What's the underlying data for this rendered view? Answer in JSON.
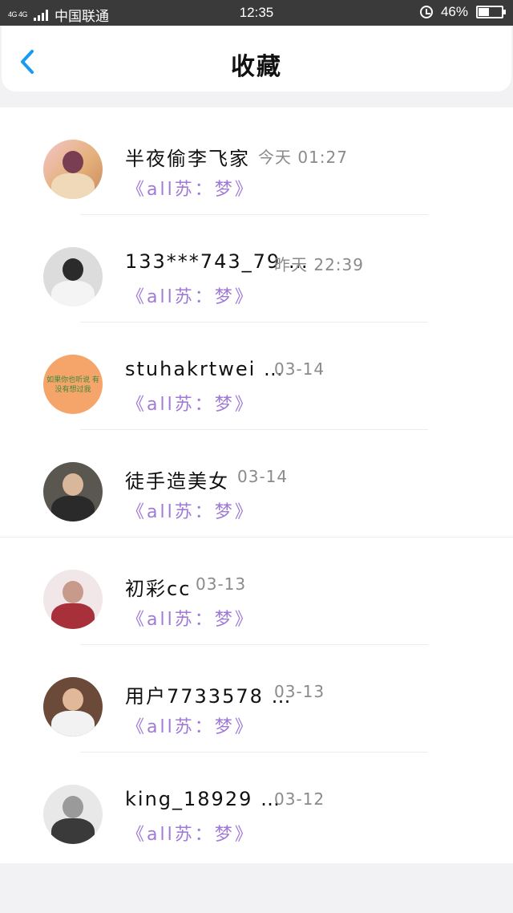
{
  "status_bar": {
    "network": "4G 4G",
    "carrier": "中国联通",
    "time": "12:35",
    "battery": "46%",
    "battery_level": 0.46
  },
  "header": {
    "title": "收藏",
    "back_icon": "chevron-left-icon",
    "accent_color": "#1a9bf0"
  },
  "items": [
    {
      "username": "半夜偷李飞家",
      "time": "今天 01:27",
      "subtitle": "《all苏：梦》"
    },
    {
      "username": "133***743_79 …",
      "time": "昨天 22:39",
      "subtitle": "《all苏：梦》"
    },
    {
      "username": "stuhakrtwei …",
      "time": "03-14",
      "subtitle": "《all苏：梦》",
      "avatar_text": "如果你也听说 有没有想过我"
    },
    {
      "username": "徒手造美女",
      "time": "03-14",
      "subtitle": "《all苏：梦》"
    },
    {
      "username": "初彩cc",
      "time": "03-13",
      "subtitle": "《all苏：梦》"
    },
    {
      "username": "用户7733578 …",
      "time": "03-13",
      "subtitle": "《all苏：梦》"
    },
    {
      "username": "king_18929 …",
      "time": "03-12",
      "subtitle": "《all苏：梦》"
    }
  ],
  "colors": {
    "subtitle": "#a07ad6",
    "timestamp": "#8a8a8a"
  }
}
